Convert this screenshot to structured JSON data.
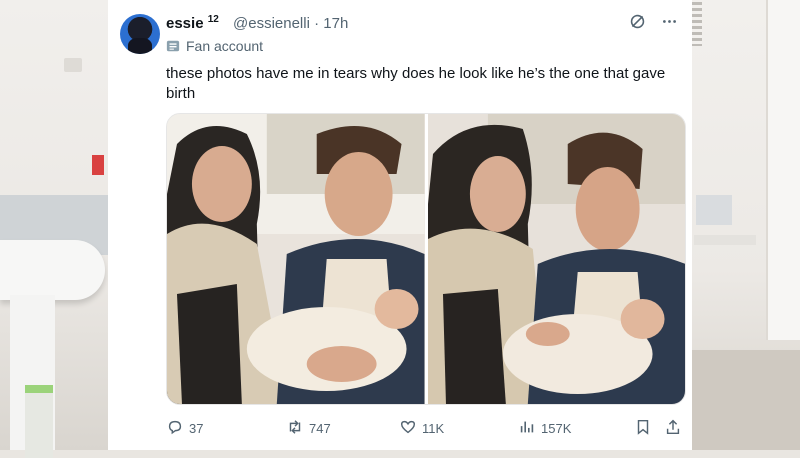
{
  "tweet": {
    "display_name": "essie",
    "name_superscript": "12",
    "handle_time": "@essienelli · 17h",
    "label": "Fan account",
    "text": "these photos have me in tears why does he look like he’s the one that gave birth",
    "actions": {
      "replies": "37",
      "reposts": "747",
      "likes": "11K",
      "views": "157K"
    }
  },
  "colors": {
    "text_primary": "#0f1419",
    "text_secondary": "#536471"
  },
  "icons": [
    "grok-icon",
    "more-icon",
    "badge-icon",
    "reply-icon",
    "repost-icon",
    "like-icon",
    "views-icon",
    "bookmark-icon",
    "share-icon"
  ]
}
